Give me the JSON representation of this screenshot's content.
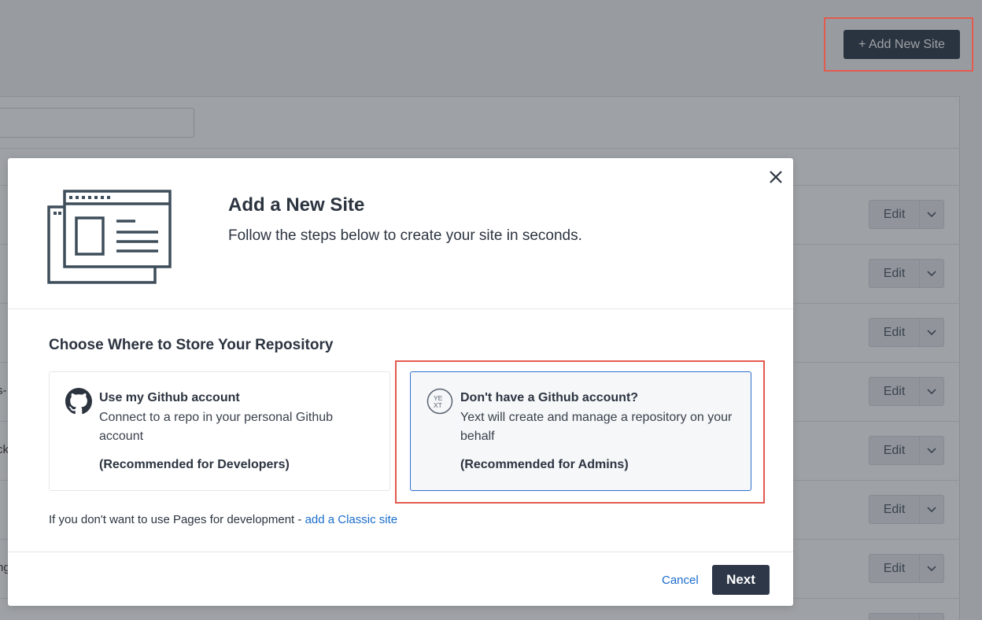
{
  "header": {
    "add_new_site_label": "+ Add New Site"
  },
  "table": {
    "rows": [
      {
        "edit_label": "Edit"
      },
      {
        "edit_label": "Edit"
      },
      {
        "edit_label": "Edit"
      },
      {
        "edit_label": "Edit"
      },
      {
        "edit_label": "Edit"
      },
      {
        "edit_label": "Edit"
      },
      {
        "edit_label": "Edit"
      }
    ],
    "cut_text": [
      "s-",
      "ck",
      "ng"
    ]
  },
  "modal": {
    "title": "Add a New Site",
    "subtitle": "Follow the steps below to create your site in seconds.",
    "section_title": "Choose Where to Store Your Repository",
    "options": [
      {
        "icon": "github-icon",
        "title": "Use my Github account",
        "description": "Connect to a repo in your personal Github account",
        "recommendation": "(Recommended for Developers)",
        "selected": false
      },
      {
        "icon": "yext-icon",
        "title": "Don't have a Github account?",
        "description": "Yext will create and manage a repository on your behalf",
        "recommendation": "(Recommended for Admins)",
        "selected": true
      }
    ],
    "classic_note": "If you don't want to use Pages for development - ",
    "classic_link": "add a Classic site",
    "cancel_label": "Cancel",
    "next_label": "Next"
  },
  "colors": {
    "primary_button": "#2d3748",
    "link": "#1a6ccc",
    "highlight": "#e35a4e",
    "selected_border": "#2f6fd1"
  }
}
